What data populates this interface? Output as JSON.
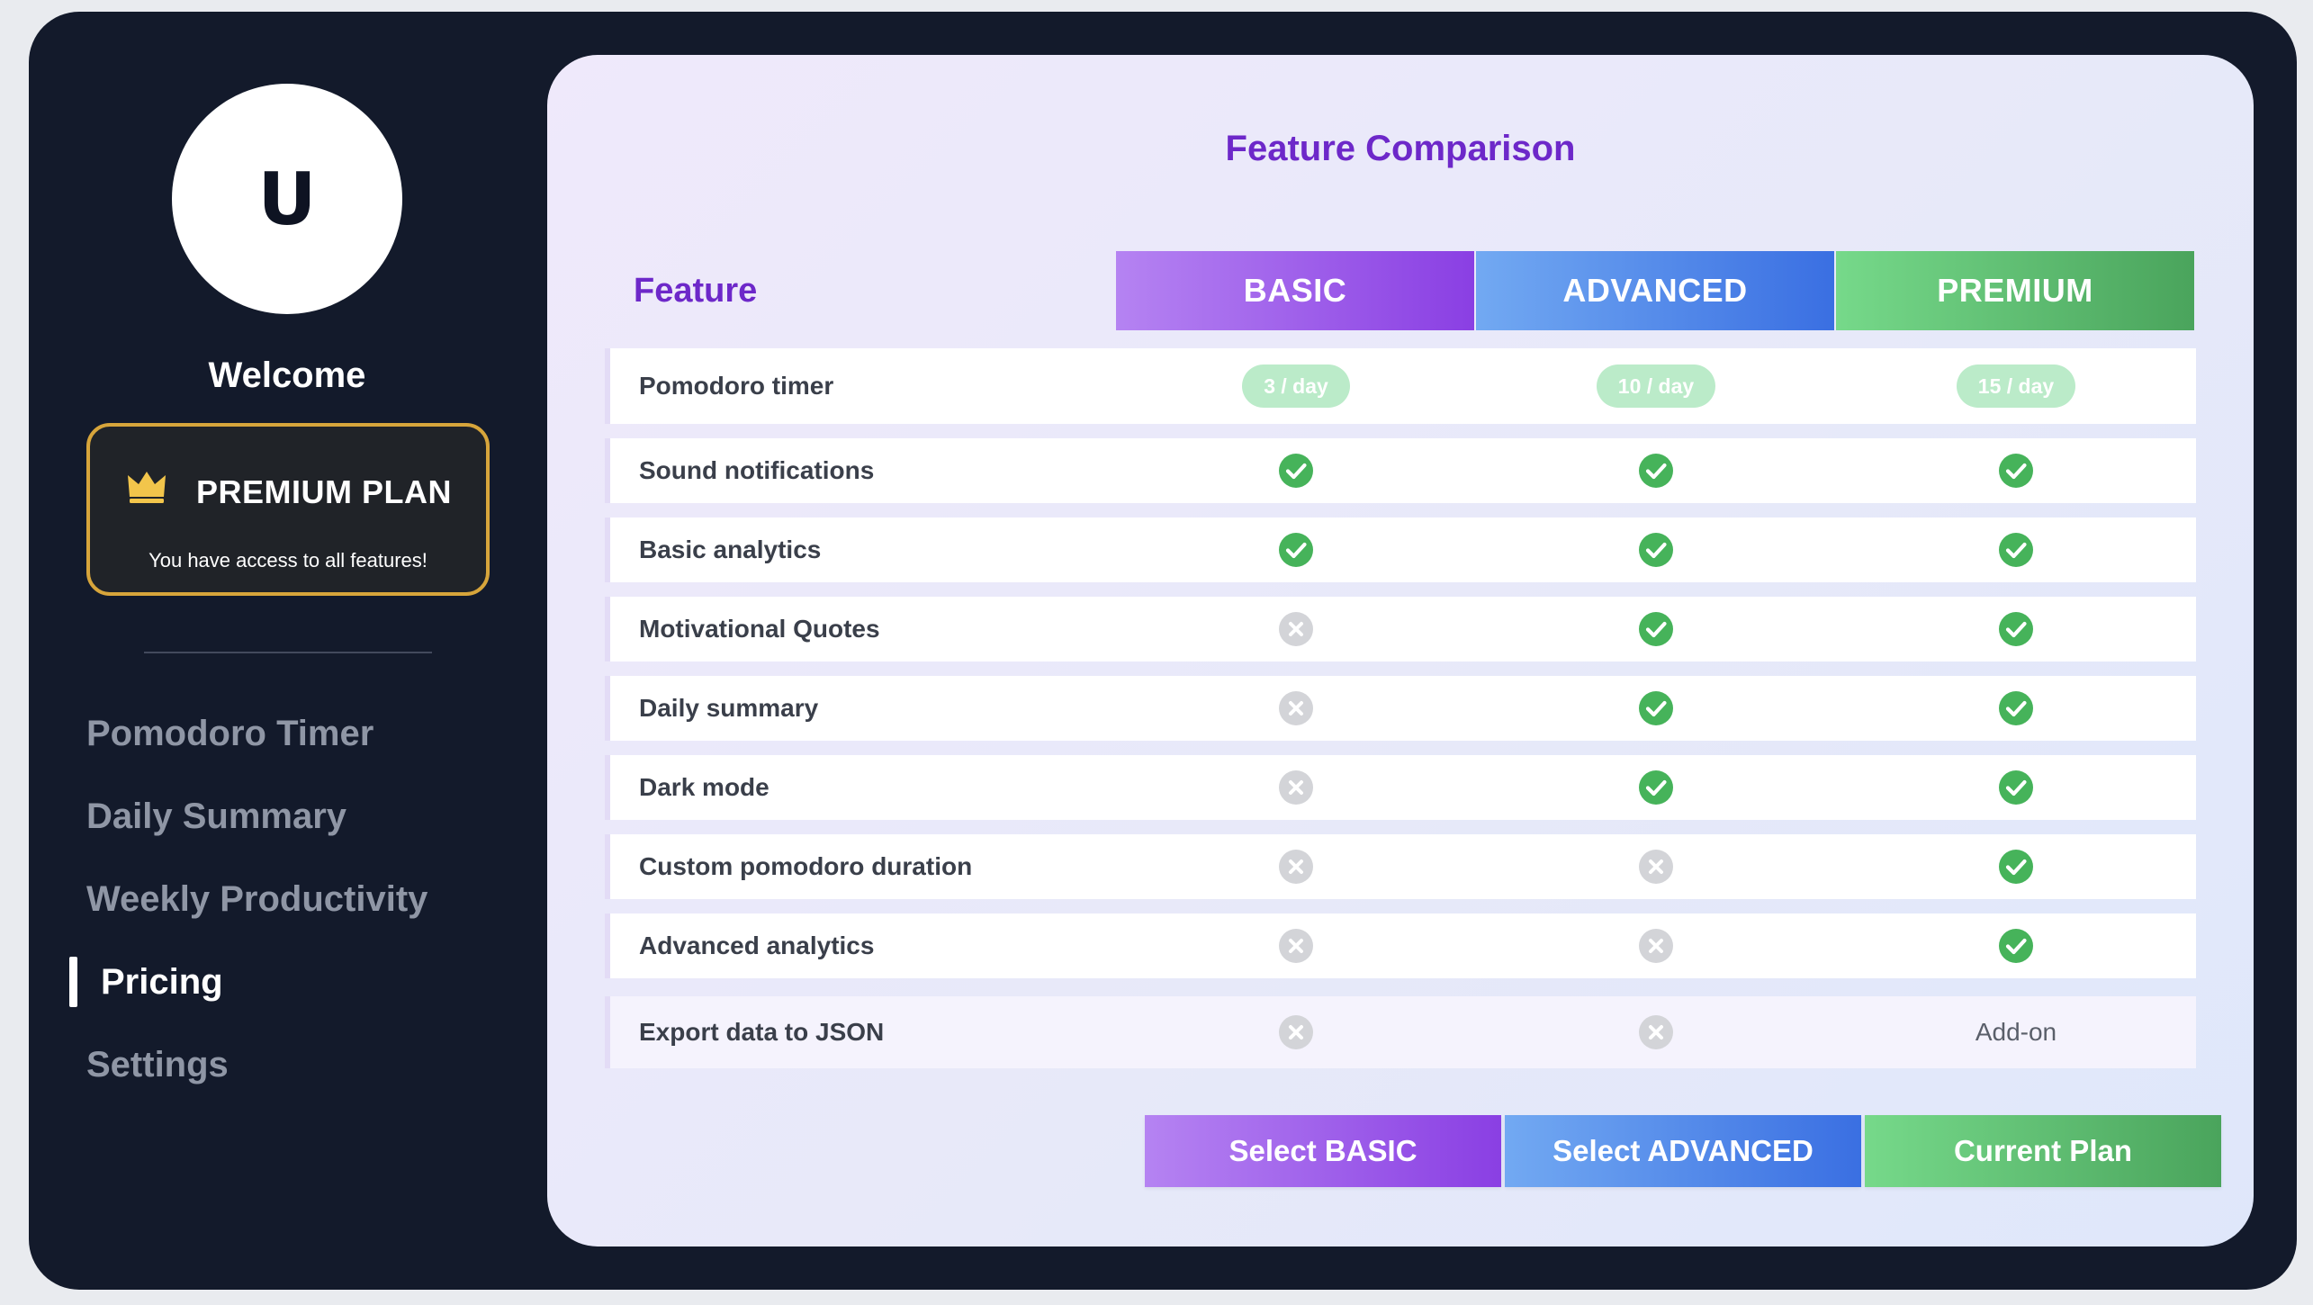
{
  "sidebar": {
    "avatar_initial": "U",
    "welcome": "Welcome",
    "plan_card": {
      "icon": "crown-icon",
      "title": "PREMIUM PLAN",
      "subtitle": "You have access to all features!",
      "border_color": "#d7a53b"
    },
    "nav": [
      {
        "label": "Pomodoro Timer",
        "active": false
      },
      {
        "label": "Daily Summary",
        "active": false
      },
      {
        "label": "Weekly Productivity",
        "active": false
      },
      {
        "label": "Pricing",
        "active": true
      },
      {
        "label": "Settings",
        "active": false
      }
    ]
  },
  "main": {
    "title": "Feature Comparison",
    "feature_header": "Feature",
    "tiers": [
      {
        "name": "BASIC",
        "color": "#8a3fe3",
        "button": "Select BASIC"
      },
      {
        "name": "ADVANCED",
        "color": "#3a6fe2",
        "button": "Select ADVANCED"
      },
      {
        "name": "PREMIUM",
        "color": "#4aa45c",
        "button": "Current Plan"
      }
    ],
    "rows": [
      {
        "feature": "Pomodoro timer",
        "values": [
          "3 / day",
          "10 / day",
          "15 / day"
        ]
      },
      {
        "feature": "Sound notifications",
        "values": [
          "check",
          "check",
          "check"
        ]
      },
      {
        "feature": "Basic analytics",
        "values": [
          "check",
          "check",
          "check"
        ]
      },
      {
        "feature": "Motivational Quotes",
        "values": [
          "cross",
          "check",
          "check"
        ]
      },
      {
        "feature": "Daily summary",
        "values": [
          "cross",
          "check",
          "check"
        ]
      },
      {
        "feature": "Dark mode",
        "values": [
          "cross",
          "check",
          "check"
        ]
      },
      {
        "feature": "Custom pomodoro duration",
        "values": [
          "cross",
          "cross",
          "check"
        ]
      },
      {
        "feature": "Advanced analytics",
        "values": [
          "cross",
          "cross",
          "check"
        ]
      },
      {
        "feature": "Export data to JSON",
        "values": [
          "cross",
          "cross",
          "Add-on"
        ]
      }
    ]
  },
  "colors": {
    "sidebar_bg": "#131a2b",
    "accent_purple": "#6d28c9",
    "check_green": "#46b35a",
    "cross_gray": "#d3d4d8",
    "pill_green": "#bbebc9"
  }
}
